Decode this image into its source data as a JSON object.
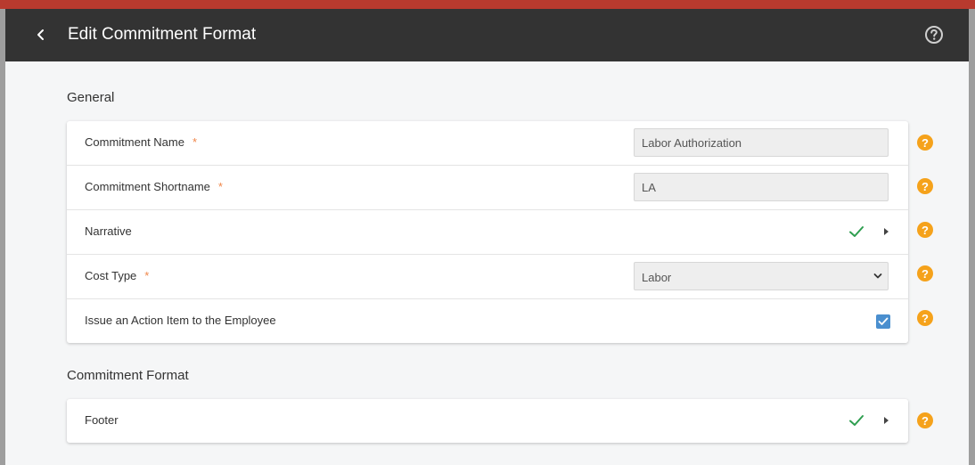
{
  "header": {
    "title": "Edit Commitment Format"
  },
  "general": {
    "title": "General",
    "commitment_name": {
      "label": "Commitment Name",
      "required": "*",
      "value": "Labor Authorization"
    },
    "commitment_shortname": {
      "label": "Commitment Shortname",
      "required": "*",
      "value": "LA"
    },
    "narrative": {
      "label": "Narrative"
    },
    "cost_type": {
      "label": "Cost Type",
      "required": "*",
      "value": "Labor"
    },
    "issue_action": {
      "label": "Issue an Action Item to the Employee",
      "checked": true
    }
  },
  "commitment_format": {
    "title": "Commitment Format",
    "footer": {
      "label": "Footer"
    }
  },
  "help_glyph": "?",
  "colors": {
    "header_bg": "#333333",
    "help_accent": "#f5a21b",
    "required": "#f0874a",
    "check_green": "#2e9e4f",
    "checkbox_blue": "#4a8fcf"
  }
}
